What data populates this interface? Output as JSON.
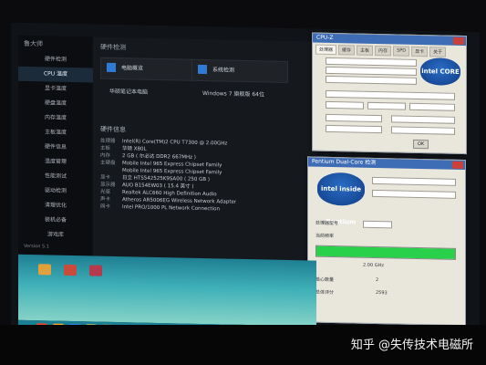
{
  "sidebar": {
    "title": "鲁大师",
    "items": [
      "硬件检测",
      "CPU 温度",
      "显卡温度",
      "硬盘温度",
      "内存温度",
      "主板温度",
      "硬件信息",
      "温度管理",
      "性能测试",
      "驱动检测",
      "清理优化",
      "装机必备",
      "游戏库"
    ],
    "active_index": 1,
    "footer": "Version 5.1"
  },
  "main": {
    "header": "硬件检测",
    "computer_box": "电脑概览",
    "system_box": "系统检测",
    "computer_sub": "华硕笔记本电脑",
    "system_sub": "Windows 7 旗舰版 64位",
    "spec_title": "硬件信息",
    "specs": [
      {
        "k": "处理器",
        "v": "Intel(R) Core(TM)2 CPU    T7300  @ 2.00GHz"
      },
      {
        "k": "主板",
        "v": "华硕 X80L"
      },
      {
        "k": "内存",
        "v": "2 GB ( 尔必达 DDR2 667MHz )"
      },
      {
        "k": "主硬盘",
        "v": "Mobile Intel 965 Express Chipset Family"
      },
      {
        "k": "",
        "v": "Mobile Intel 965 Express Chipset Family"
      },
      {
        "k": "显卡",
        "v": "日立 HTS542525K9SA00 ( 250 GB )"
      },
      {
        "k": "显示器",
        "v": "AUO B154EW03 ( 15.4 英寸 )"
      },
      {
        "k": "光驱",
        "v": "Realtek ALC660 High Definition Audio"
      },
      {
        "k": "声卡",
        "v": "Atheros AR5006EG Wireless Network Adapter"
      },
      {
        "k": "网卡",
        "v": "Intel PRO/1000 PL Network Connection"
      }
    ]
  },
  "cpuz": {
    "title": "CPU-Z",
    "tabs": [
      "处理器",
      "缓存",
      "主板",
      "内存",
      "SPD",
      "显卡",
      "关于"
    ],
    "logo": "intel CORE"
  },
  "pentium": {
    "title": "Pentium Dual-Core 检测",
    "logo": "intel inside Pentium",
    "row1_label": "处理器型号",
    "row2_label": "当前频率",
    "progress_percent": 100,
    "speed_label": "2.00 GHz",
    "bottom_label1": "核心数量",
    "bottom_value1": "2",
    "bottom_label2": "总体评分",
    "bottom_value2": "2593"
  },
  "watermark": "知乎 @失传技术电磁所"
}
